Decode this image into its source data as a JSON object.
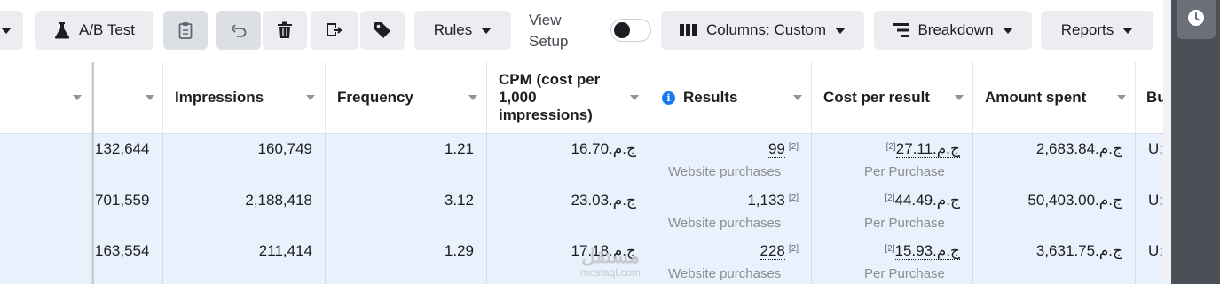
{
  "toolbar": {
    "ab_test_label": "A/B Test",
    "rules_label": "Rules",
    "view_setup_line1": "View",
    "view_setup_line2": "Setup",
    "columns_label": "Columns: Custom",
    "breakdown_label": "Breakdown",
    "reports_label": "Reports"
  },
  "table": {
    "headers": {
      "impressions": "Impressions",
      "frequency": "Frequency",
      "cpm_line1": "CPM (cost per",
      "cpm_line2": "1,000",
      "cpm_line3": "impressions)",
      "results": "Results",
      "cost_per_result": "Cost per result",
      "amount_spent": "Amount spent",
      "next_col": "Bu"
    },
    "rows": [
      {
        "reach": "132,644",
        "impressions": "160,749",
        "frequency": "1.21",
        "cpm": "ج.م.16.70",
        "results": "99",
        "results_fn": "[2]",
        "results_sub": "Website purchases",
        "cpr": "ج.م.27.11",
        "cpr_fn": "[2]",
        "cpr_sub": "Per Purchase",
        "spent": "ج.م.2,683.84",
        "next": "U:"
      },
      {
        "reach": "701,559",
        "impressions": "2,188,418",
        "frequency": "3.12",
        "cpm": "ج.م.23.03",
        "results": "1,133",
        "results_fn": "[2]",
        "results_sub": "Website purchases",
        "cpr": "ج.م.44.49",
        "cpr_fn": "[2]",
        "cpr_sub": "Per Purchase",
        "spent": "ج.م.50,403.00",
        "next": "U:"
      },
      {
        "reach": "163,554",
        "impressions": "211,414",
        "frequency": "1.29",
        "cpm": "ج.م.17.18",
        "results": "228",
        "results_fn": "[2]",
        "results_sub": "Website purchases",
        "cpr": "ج.م.15.93",
        "cpr_fn": "[2]",
        "cpr_sub": "Per Purchase",
        "spent": "ج.م.3,631.75",
        "next": "U:"
      }
    ]
  },
  "watermark": {
    "line1": "مستقل",
    "line2": "mostaql.com"
  },
  "colors": {
    "row_selected": "#e9f1fc",
    "info_icon": "#1877f2",
    "side_panel": "#4b4f56"
  }
}
